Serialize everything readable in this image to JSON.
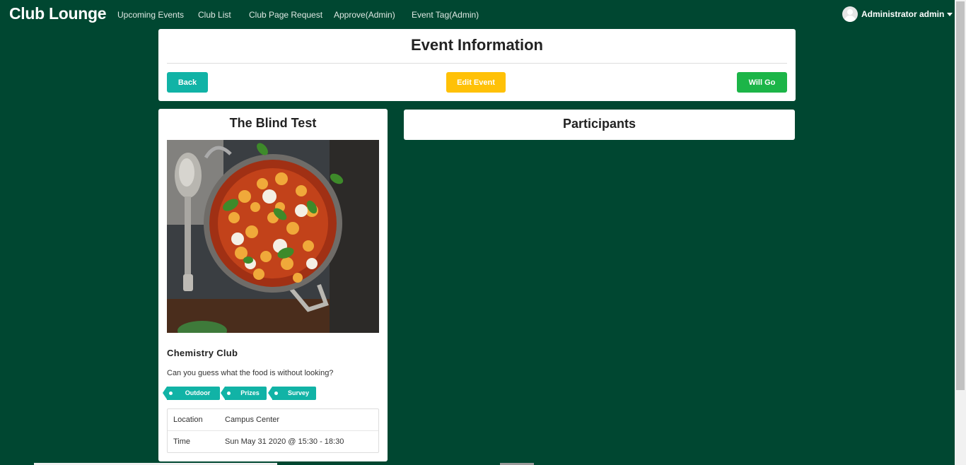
{
  "navbar": {
    "brand": "Club Lounge",
    "links": [
      "Upcoming Events",
      "Club List",
      "Club Page Request",
      "Approve(Admin)",
      "Event Tag(Admin)"
    ],
    "user_name": "Administrator admin"
  },
  "event_info": {
    "title": "Event Information",
    "back_label": "Back",
    "edit_label": "Edit Event",
    "go_label": "Will Go",
    "colors": {
      "back": "#11b3a6",
      "edit": "#ffc107",
      "go": "#1cb548"
    }
  },
  "event": {
    "name": "The Blind Test",
    "image_icon": "gnocchi-dish-photo",
    "club": "Chemistry Club",
    "description": "Can you guess what the food is without looking?",
    "tags": [
      "Outdoor",
      "Prizes",
      "Survey"
    ],
    "location_label": "Location",
    "location": "Campus Center",
    "time_label": "Time",
    "time": "Sun May 31 2020 @ 15:30 - 18:30"
  },
  "participants": {
    "title": "Participants"
  },
  "theme": {
    "background": "#004731"
  }
}
